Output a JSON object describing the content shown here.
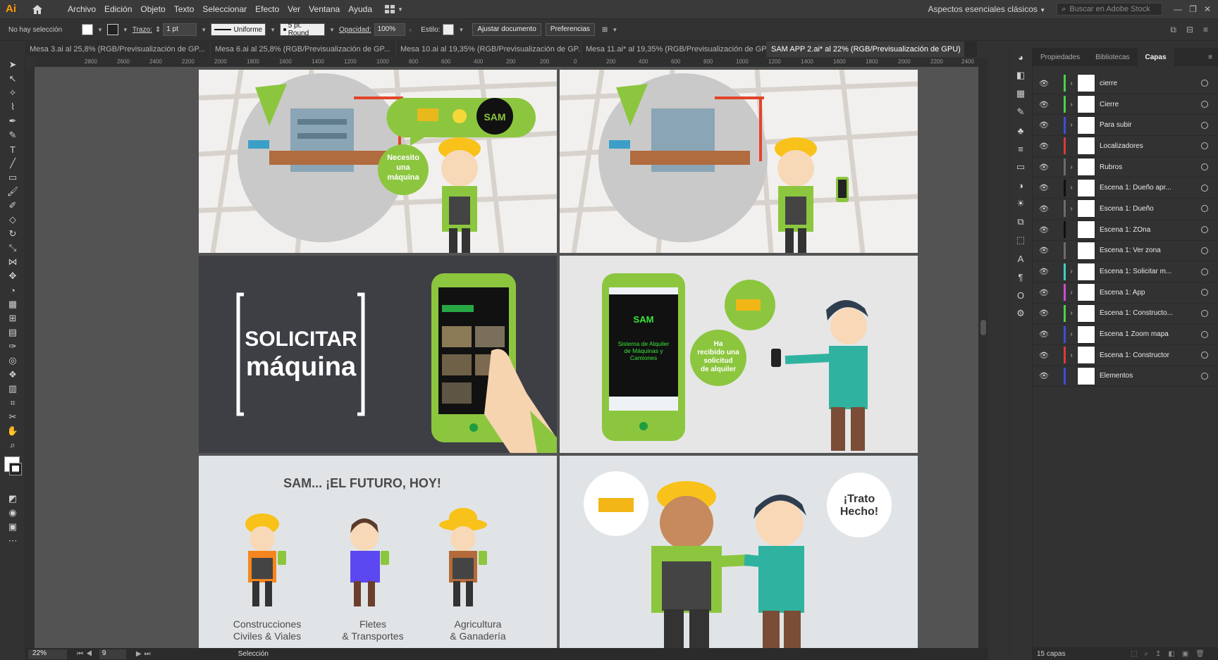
{
  "app": {
    "logo": "Ai"
  },
  "menubar": {
    "items": [
      "Archivo",
      "Edición",
      "Objeto",
      "Texto",
      "Seleccionar",
      "Efecto",
      "Ver",
      "Ventana",
      "Ayuda"
    ],
    "workspace": "Aspectos esenciales clásicos",
    "search_placeholder": "Buscar en Adobe Stock"
  },
  "controlbar": {
    "selection": "No hay selección",
    "stroke_label": "Trazo:",
    "stroke_value": "1 pt",
    "stroke_profile": "Uniforme",
    "brush": "5 pt. Round",
    "opacity_label": "Opacidad:",
    "opacity_value": "100%",
    "style_label": "Estilo:",
    "fit_button": "Ajustar documento",
    "prefs_button": "Preferencias"
  },
  "tabs": [
    {
      "label": "Mesa 3.ai al 25,8% (RGB/Previsualización de GP...",
      "active": false
    },
    {
      "label": "Mesa 6.ai al 25,8% (RGB/Previsualización de GP...",
      "active": false
    },
    {
      "label": "Mesa 10.ai al 19,35% (RGB/Previsualización de GP...",
      "active": false
    },
    {
      "label": "Mesa 11.ai* al 19,35% (RGB/Previsualización de GP...",
      "active": false
    },
    {
      "label": "SAM APP 2.ai* al 22% (RGB/Previsualización de GPU)",
      "active": true
    }
  ],
  "ruler": {
    "left_ticks": [
      "2800",
      "2600",
      "2400",
      "2200",
      "2000",
      "1800",
      "1600",
      "1400",
      "1200",
      "1000",
      "800",
      "600",
      "400",
      "200"
    ],
    "right_ticks": [
      "200",
      "0",
      "200",
      "400",
      "600",
      "800",
      "1000",
      "1200",
      "1400",
      "1600",
      "1800",
      "2000",
      "2200",
      "2400"
    ]
  },
  "artwork": {
    "bubble_need": [
      "Necesito",
      "una",
      "máquina"
    ],
    "logo_text": "SAM",
    "solicitar": "SOLICITAR",
    "maquina": "máquina",
    "app_title": [
      "Sistema de Alquiler",
      "de Máquinas y",
      "Camiones"
    ],
    "received": [
      "Ha",
      "recibido una",
      "solicitud",
      "de alquiler"
    ],
    "futuro": "SAM... ¡EL FUTURO, HOY!",
    "sector1": [
      "Construcciones",
      "Civiles & Viales"
    ],
    "sector2": [
      "Fletes",
      "& Transportes"
    ],
    "sector3": [
      "Agricultura",
      "& Ganadería"
    ],
    "deal": [
      "¡Trato",
      "Hecho!"
    ]
  },
  "status": {
    "zoom": "22%",
    "page": "9",
    "mode": "Selección"
  },
  "panel": {
    "tabs": [
      "Propiedades",
      "Bibliotecas",
      "Capas"
    ],
    "active_tab": "Capas",
    "layers": [
      {
        "name": "cierre",
        "color": "#4cd04c",
        "expand": true
      },
      {
        "name": "Cierre",
        "color": "#4cd04c",
        "expand": true
      },
      {
        "name": "Para subir",
        "color": "#3b4fd8",
        "expand": true
      },
      {
        "name": "Localizadores",
        "color": "#d83b3b",
        "expand": false
      },
      {
        "name": "Rubros",
        "color": "#6b6b6b",
        "expand": true
      },
      {
        "name": "Escena 1: Dueño apr...",
        "color": "#111111",
        "expand": true
      },
      {
        "name": "Escena 1: Dueño",
        "color": "#6b6b6b",
        "expand": true
      },
      {
        "name": "Escena 1: ZOna",
        "color": "#111111",
        "expand": false
      },
      {
        "name": "Escena 1: Ver zona",
        "color": "#6b6b6b",
        "expand": false
      },
      {
        "name": "Escena 1: Solicitar m...",
        "color": "#3fd0c0",
        "expand": true
      },
      {
        "name": "Escena 1: App",
        "color": "#d04cd0",
        "expand": true
      },
      {
        "name": "Escena 1: Constructo...",
        "color": "#4cd04c",
        "expand": true
      },
      {
        "name": "Escena 1 Zoom mapa",
        "color": "#3b4fd8",
        "expand": true
      },
      {
        "name": "Escena 1: Constructor",
        "color": "#d83b3b",
        "expand": true
      },
      {
        "name": "Elementos",
        "color": "#3b4fd8",
        "expand": false
      }
    ],
    "footer": "15 capas"
  }
}
